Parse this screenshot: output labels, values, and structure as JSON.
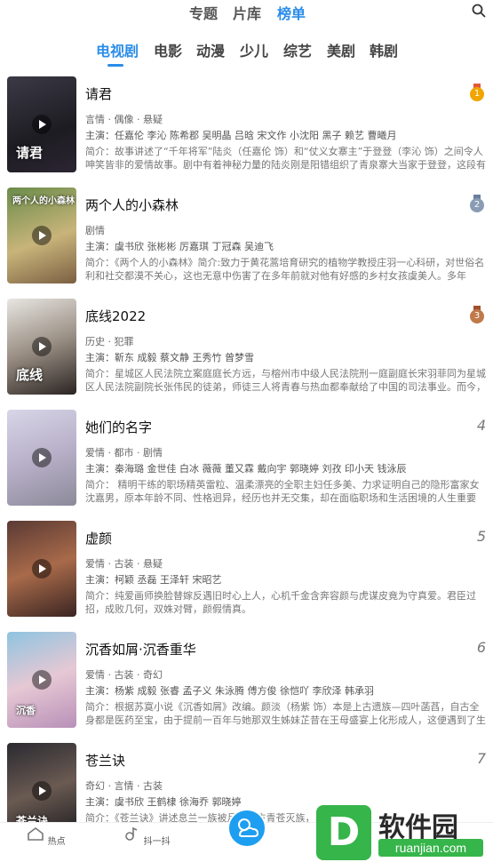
{
  "top_tabs": [
    "专题",
    "片库",
    "榜单"
  ],
  "categories": [
    "电视剧",
    "电影",
    "动漫",
    "少儿",
    "综艺",
    "美剧",
    "韩剧"
  ],
  "items": [
    {
      "title": "请君",
      "tags": "言情 · 偶像 · 悬疑",
      "cast": "主演：任嘉伦 李沁 陈希郡 吴明晶 吕晗 宋文作 小沈阳 黑子 赖艺 曹曦月",
      "desc": "简介：故事讲述了“千年将军”陆炎（任嘉伦 饰）和“仗义女寨主”于登登（李沁 饰）之间令人呻笑皆非的爱情故事。剧中有着神秘力量的陆炎刚是阳错组织了青泉寨大当家于登登，这段有着千…",
      "rank": "1",
      "poster_caption": "请君"
    },
    {
      "title": "两个人的小森林",
      "tags": "剧情",
      "cast": "主演：虞书欣 张彬彬 厉嘉琪 丁冠森 吴迪飞",
      "desc": "简介：《两个人的小森林》简介:致力于黄花蒿培育研究的植物学教授庄羽一心科研，对世俗名利和社交都漠不关心，这也无意中伤害了在多年前就对他有好感的乡村女孩虞美人。多年后，…",
      "rank": "2",
      "poster_caption": "两个人的小森林"
    },
    {
      "title": "底线2022",
      "tags": "历史 · 犯罪",
      "cast": "主演：靳东 成毅 蔡文静 王秀竹 曾梦雪",
      "desc": "简介：星城区人民法院立案庭庭长方远，与榕州市中级人民法院刑一庭副庭长宋羽菲同为星城区人民法院副院长张伟民的徒弟，师徒三人将青春与热血都奉献给了中国的司法事业。而今，方…",
      "rank": "3",
      "poster_caption": "底线"
    },
    {
      "title": "她们的名字",
      "tags": "爱情 · 都市 · 剧情",
      "cast": "主演：秦海璐 金世佳 白冰 薇薇 董又霖 戴向宇 郭晓婷 刘孜 印小天 钱泳辰",
      "desc": "简介：    精明干练的职场精英雷粒、温柔漂亮的全职主妇任多美、力求证明自己的隐形富家女沈嘉男，原本年龄不同、性格迥异，经历也并无交集，却在面临职场和生活困境的人生重要节…",
      "rank": "4",
      "poster_caption": ""
    },
    {
      "title": "虚颜",
      "tags": "爱情 · 古装 · 悬疑",
      "cast": "主演：柯颖 丞磊 王泽轩 宋昭艺",
      "desc": "简介：纯爱画师换脸替嫁反遇旧时心上人，心机千金含奔容颜与虎谋皮竟为守真爱。君臣过招，成败几何，双姝对臂，颜假情真。",
      "rank": "5",
      "poster_caption": ""
    },
    {
      "title": "沉香如屑·沉香重华",
      "tags": "爱情 · 古装 · 奇幻",
      "cast": "主演：杨紫 成毅 张睿 孟子义 朱泳腾 傅方俊 徐恺吖 李欣泽 韩承羽",
      "desc": "简介：根据苏寞小说《沉香如屑》改编。颜淡（杨紫 饰）本是上古遗族—四叶菡萏，自古全身都是医药至宝，由于提前一百年与她那双生姊妹芷昔在王母盛宴上化形成人，这便遇到了生平…",
      "rank": "6",
      "poster_caption": "沉香"
    },
    {
      "title": "苍兰诀",
      "tags": "奇幻 · 言情 · 古装",
      "cast": "主演：虞书欣 王鹤棣 徐海乔 郭晓婷",
      "desc": "简介：《苍兰诀》讲述息兰一族被月尊东方青苍灭族，…",
      "rank": "7",
      "poster_caption": "苍兰诀"
    }
  ],
  "bottom_nav": [
    "热点",
    "抖一抖"
  ],
  "colors": {
    "accent": "#2b8de8",
    "gold": "#f0a500",
    "silver": "#8a9cb4",
    "bronze": "#c07a4a",
    "wm_green": "#36b54a"
  },
  "watermark": {
    "letter": "D",
    "text": "软件园",
    "url": "ruanjian.com"
  }
}
